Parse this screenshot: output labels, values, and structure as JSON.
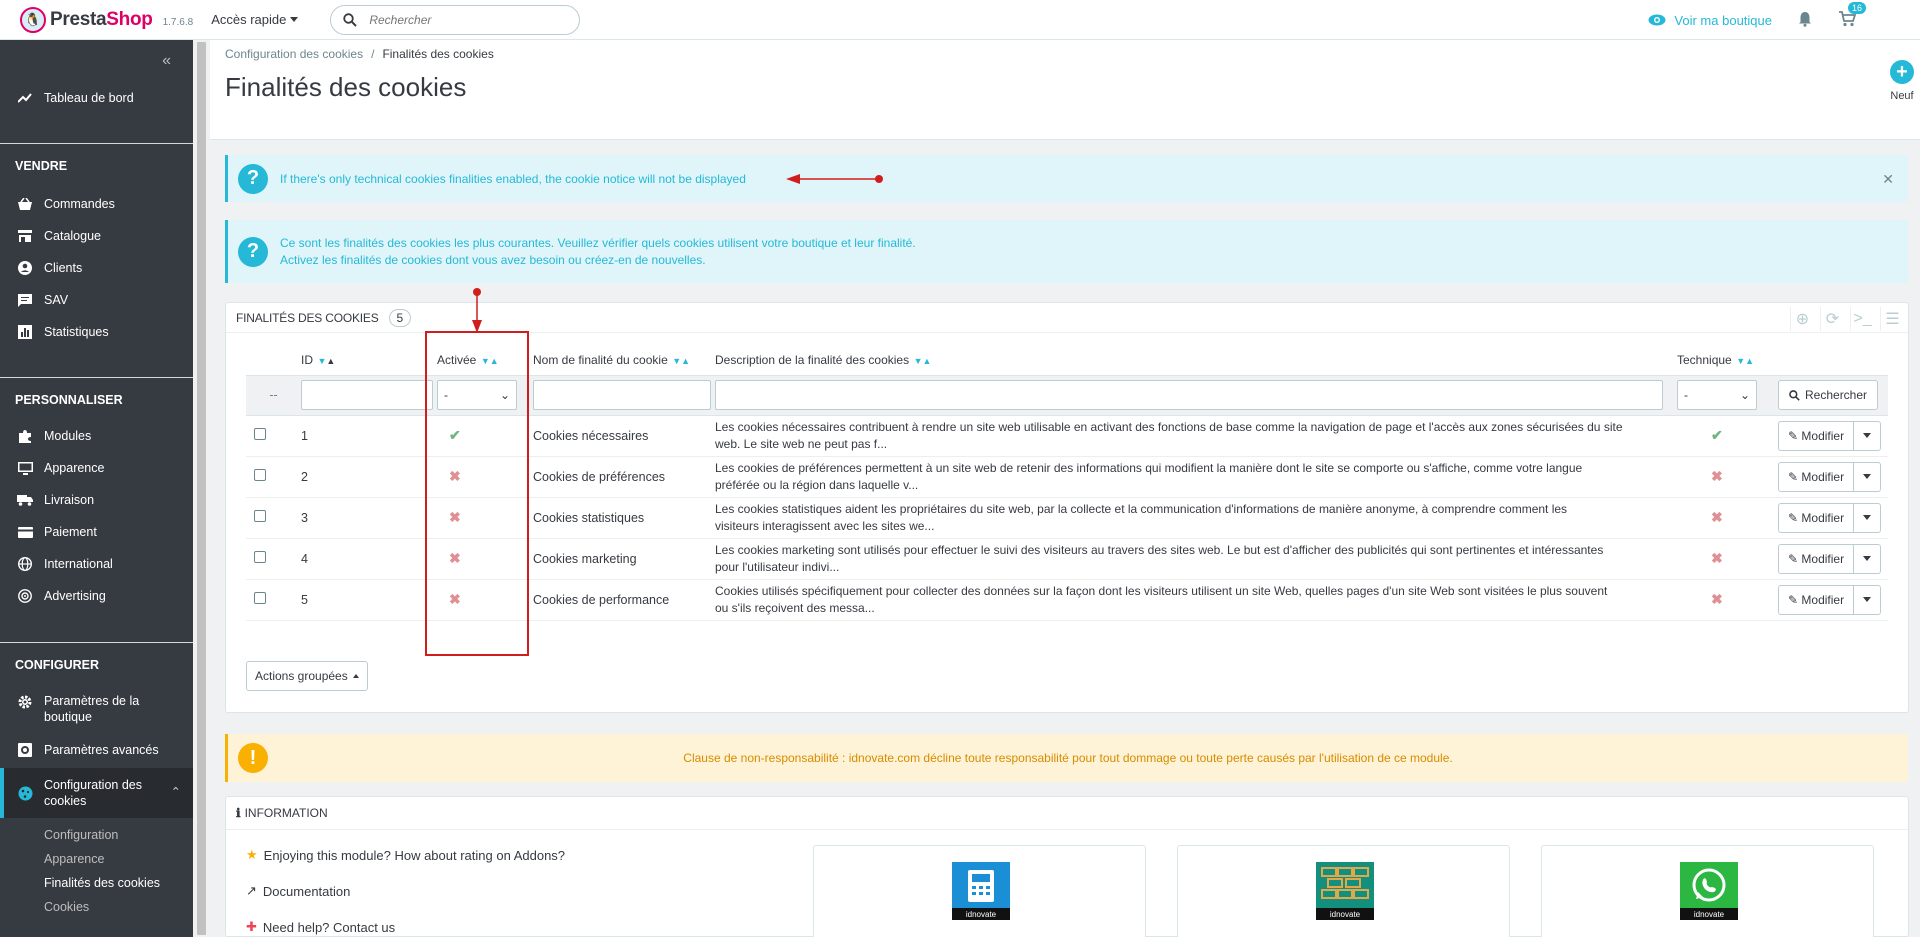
{
  "topbar": {
    "logo_text_1": "Presta",
    "logo_text_2": "Shop",
    "version": "1.7.6.8",
    "quick_access": "Accès rapide",
    "search_placeholder": "Rechercher",
    "view_shop": "Voir ma boutique",
    "cart_count": "16"
  },
  "sidebar": {
    "dashboard": "Tableau de bord",
    "section_sell": "VENDRE",
    "sell_items": [
      "Commandes",
      "Catalogue",
      "Clients",
      "SAV",
      "Statistiques"
    ],
    "section_customize": "PERSONNALISER",
    "customize_items": [
      "Modules",
      "Apparence",
      "Livraison",
      "Paiement",
      "International",
      "Advertising"
    ],
    "section_configure": "CONFIGURER",
    "shop_params_line1": "Paramètres de la",
    "shop_params_line2": "boutique",
    "advanced_params": "Paramètres avancés",
    "cookie_config_line1": "Configuration des",
    "cookie_config_line2": "cookies",
    "sub_items": [
      "Configuration",
      "Apparence",
      "Finalités des cookies",
      "Cookies"
    ]
  },
  "header": {
    "breadcrumb_parent": "Configuration des cookies",
    "breadcrumb_sep": "/",
    "breadcrumb_current": "Finalités des cookies",
    "title": "Finalités des cookies",
    "new_label": "Neuf"
  },
  "alerts": {
    "technical_notice": "If there's only technical cookies finalities enabled, the cookie notice will not be displayed",
    "info_line1": "Ce sont les finalités des cookies les plus courantes. Veuillez vérifier quels cookies utilisent votre boutique et leur finalité.",
    "info_line2": "Activez les finalités de cookies dont vous avez besoin ou créez-en de nouvelles.",
    "disclaimer": "Clause de non-responsabilité : idnovate.com décline toute responsabilité pour tout dommage ou toute perte causés par l'utilisation de ce module."
  },
  "list": {
    "title": "Finalités des cookies",
    "count": "5",
    "columns": {
      "id": "ID",
      "active": "Activée",
      "name": "Nom de finalité du cookie",
      "description": "Description de la finalité des cookies",
      "technical": "Technique"
    },
    "filter_reset": "--",
    "filter_select_value": "-",
    "search_button": "Rechercher",
    "rows": [
      {
        "id": "1",
        "active": true,
        "name": "Cookies nécessaires",
        "desc1": "Les cookies nécessaires contribuent à rendre un site web utilisable en activant des fonctions de base comme la navigation de page et l'accès aux zones sécurisées du site",
        "desc2": "web. Le site web ne peut pas f...",
        "technical": true
      },
      {
        "id": "2",
        "active": false,
        "name": "Cookies de préférences",
        "desc1": "Les cookies de préférences permettent à un site web de retenir des informations qui modifient la manière dont le site se comporte ou s'affiche, comme votre langue",
        "desc2": "préférée ou la région dans laquelle v...",
        "technical": false
      },
      {
        "id": "3",
        "active": false,
        "name": "Cookies statistiques",
        "desc1": "Les cookies statistiques aident les propriétaires du site web, par la collecte et la communication d'informations de manière anonyme, à comprendre comment les",
        "desc2": "visiteurs interagissent avec les sites we...",
        "technical": false
      },
      {
        "id": "4",
        "active": false,
        "name": "Cookies marketing",
        "desc1": "Les cookies marketing sont utilisés pour effectuer le suivi des visiteurs au travers des sites web. Le but est d'afficher des publicités qui sont pertinentes et intéressantes",
        "desc2": "pour l'utilisateur indivi...",
        "technical": false
      },
      {
        "id": "5",
        "active": false,
        "name": "Cookies de performance",
        "desc1": "Cookies utilisés spécifiquement pour collecter des données sur la façon dont les visiteurs utilisent un site Web, quelles pages d'un site Web sont visitées le plus souvent",
        "desc2": "ou s'ils reçoivent des messa...",
        "technical": false
      }
    ],
    "edit_label": "Modifier",
    "bulk_actions": "Actions groupées"
  },
  "info": {
    "title": "Information",
    "rating": "Enjoying this module? How about rating on Addons?",
    "documentation": "Documentation",
    "help": "Need help? Contact us",
    "card_brand": "idnovate"
  },
  "colors": {
    "accent": "#25b9d7",
    "sidebar_bg": "#363a41",
    "success": "#70b580",
    "danger": "#e08f95",
    "warning": "#fab000",
    "annotation": "#d01e1e"
  }
}
